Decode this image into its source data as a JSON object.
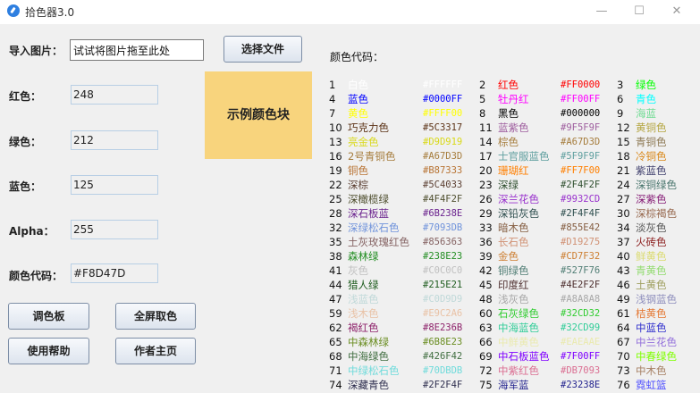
{
  "window": {
    "title": "拾色器3.0",
    "minimize": "—",
    "maximize": "☐",
    "close": "✕"
  },
  "import": {
    "label": "导入图片：",
    "placeholder": "试试将图片拖至此处",
    "select_button": "选择文件"
  },
  "fields": {
    "red": {
      "label": "红色：",
      "value": "248"
    },
    "green": {
      "label": "绿色：",
      "value": "212"
    },
    "blue": {
      "label": "蓝色：",
      "value": "125"
    },
    "alpha": {
      "label": "Alpha：",
      "value": "255"
    },
    "code": {
      "label": "颜色代码：",
      "value": "#F8D47D"
    }
  },
  "swatch": {
    "label": "示例颜色块",
    "color": "#F8D47D"
  },
  "buttons": {
    "palette": "调色板",
    "fullscreen": "全屏取色",
    "help": "使用帮助",
    "author": "作者主页"
  },
  "codes_title": "颜色代码：",
  "colors": [
    {
      "n": "1",
      "name": "白色",
      "hex": "#FFFFFF"
    },
    {
      "n": "2",
      "name": "红色",
      "hex": "#FF0000"
    },
    {
      "n": "3",
      "name": "绿色",
      "hex": "#00FF00"
    },
    {
      "n": "4",
      "name": "蓝色",
      "hex": "#0000FF"
    },
    {
      "n": "5",
      "name": "牡丹红",
      "hex": "#FF00FF"
    },
    {
      "n": "6",
      "name": "青色",
      "hex": "#00FFFF"
    },
    {
      "n": "7",
      "name": "黄色",
      "hex": "#FFFF00"
    },
    {
      "n": "8",
      "name": "黑色",
      "hex": "#000000"
    },
    {
      "n": "9",
      "name": "海蓝",
      "hex": "#70DB93"
    },
    {
      "n": "10",
      "name": "巧克力色",
      "hex": "#5C3317"
    },
    {
      "n": "11",
      "name": "蓝紫色",
      "hex": "#9F5F9F"
    },
    {
      "n": "12",
      "name": "黄铜色",
      "hex": "#B5A642"
    },
    {
      "n": "13",
      "name": "亮金色",
      "hex": "#D9D919"
    },
    {
      "n": "14",
      "name": "棕色",
      "hex": "#A67D3D"
    },
    {
      "n": "15",
      "name": "青铜色",
      "hex": "#8C7853"
    },
    {
      "n": "16",
      "name": "2号青铜色",
      "hex": "#A67D3D"
    },
    {
      "n": "17",
      "name": "士官服蓝色",
      "hex": "#5F9F9F"
    },
    {
      "n": "18",
      "name": "冷铜色",
      "hex": "#D98719"
    },
    {
      "n": "19",
      "name": "铜色",
      "hex": "#B87333"
    },
    {
      "n": "20",
      "name": "珊瑚红",
      "hex": "#FF7F00"
    },
    {
      "n": "21",
      "name": "紫蓝色",
      "hex": "#42426F"
    },
    {
      "n": "22",
      "name": "深棕",
      "hex": "#5C4033"
    },
    {
      "n": "23",
      "name": "深绿",
      "hex": "#2F4F2F"
    },
    {
      "n": "24",
      "name": "深铜绿色",
      "hex": "#4A766E"
    },
    {
      "n": "25",
      "name": "深橄榄绿",
      "hex": "#4F4F2F"
    },
    {
      "n": "26",
      "name": "深兰花色",
      "hex": "#9932CD"
    },
    {
      "n": "27",
      "name": "深紫色",
      "hex": "#871F78"
    },
    {
      "n": "28",
      "name": "深石板蓝",
      "hex": "#6B238E"
    },
    {
      "n": "29",
      "name": "深铅灰色",
      "hex": "#2F4F4F"
    },
    {
      "n": "30",
      "name": "深棕褐色",
      "hex": "#97694F"
    },
    {
      "n": "32",
      "name": "深绿松石色",
      "hex": "#7093DB"
    },
    {
      "n": "33",
      "name": "暗木色",
      "hex": "#855E42"
    },
    {
      "n": "34",
      "name": "淡灰色",
      "hex": "#545454"
    },
    {
      "n": "35",
      "name": "土灰玫瑰红色",
      "hex": "#856363"
    },
    {
      "n": "36",
      "name": "长石色",
      "hex": "#D19275"
    },
    {
      "n": "37",
      "name": "火砖色",
      "hex": "#8E2323"
    },
    {
      "n": "38",
      "name": "森林绿",
      "hex": "#238E23"
    },
    {
      "n": "39",
      "name": "金色",
      "hex": "#CD7F32"
    },
    {
      "n": "40",
      "name": "鲜黄色",
      "hex": "#DBDB70"
    },
    {
      "n": "41",
      "name": "灰色",
      "hex": "#C0C0C0"
    },
    {
      "n": "42",
      "name": "铜绿色",
      "hex": "#527F76"
    },
    {
      "n": "43",
      "name": "青黄色",
      "hex": "#93DB70"
    },
    {
      "n": "44",
      "name": "猎人绿",
      "hex": "#215E21"
    },
    {
      "n": "45",
      "name": "印度红",
      "hex": "#4E2F2F"
    },
    {
      "n": "46",
      "name": "土黄色",
      "hex": "#9F9F5F"
    },
    {
      "n": "47",
      "name": "浅蓝色",
      "hex": "#C0D9D9"
    },
    {
      "n": "48",
      "name": "浅灰色",
      "hex": "#A8A8A8"
    },
    {
      "n": "49",
      "name": "浅钢蓝色",
      "hex": "#8F8FBD"
    },
    {
      "n": "59",
      "name": "浅木色",
      "hex": "#E9C2A6"
    },
    {
      "n": "60",
      "name": "石灰绿色",
      "hex": "#32CD32"
    },
    {
      "n": "61",
      "name": "桔黄色",
      "hex": "#E47833"
    },
    {
      "n": "62",
      "name": "褐红色",
      "hex": "#8E236B"
    },
    {
      "n": "63",
      "name": "中海蓝色",
      "hex": "#32CD99"
    },
    {
      "n": "64",
      "name": "中蓝色",
      "hex": "#3232CD"
    },
    {
      "n": "65",
      "name": "中森林绿",
      "hex": "#6B8E23"
    },
    {
      "n": "66",
      "name": "中鲜黄色",
      "hex": "#EAEAAE"
    },
    {
      "n": "67",
      "name": "中兰花色",
      "hex": "#9370DB"
    },
    {
      "n": "68",
      "name": "中海绿色",
      "hex": "#426F42"
    },
    {
      "n": "69",
      "name": "中石板蓝色",
      "hex": "#7F00FF"
    },
    {
      "n": "70",
      "name": "中春绿色",
      "hex": "#7FFF00"
    },
    {
      "n": "71",
      "name": "中绿松石色",
      "hex": "#70DBDB"
    },
    {
      "n": "72",
      "name": "中紫红色",
      "hex": "#DB7093"
    },
    {
      "n": "73",
      "name": "中木色",
      "hex": "#A68064"
    },
    {
      "n": "74",
      "name": "深藏青色",
      "hex": "#2F2F4F"
    },
    {
      "n": "75",
      "name": "海军蓝",
      "hex": "#23238E"
    },
    {
      "n": "76",
      "name": "霓虹篮",
      "hex": "#4D4DFF"
    }
  ]
}
